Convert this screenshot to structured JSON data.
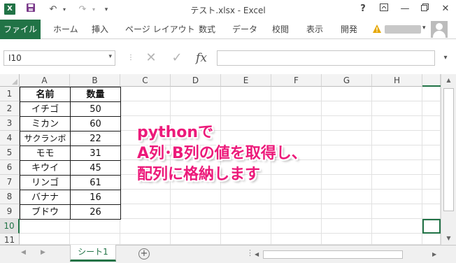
{
  "window": {
    "title": "テスト.xlsx - Excel",
    "help": "?",
    "app_icon": "X"
  },
  "quick_access": {
    "save_icon": "save-icon",
    "undo_icon": "undo-icon",
    "redo_icon": "redo-icon"
  },
  "ribbon": {
    "file_tab": "ファイル",
    "tabs": [
      "ホーム",
      "挿入",
      "ページ レイアウト",
      "数式",
      "データ",
      "校閲",
      "表示",
      "開発"
    ]
  },
  "formula_bar": {
    "name_box": "I10",
    "fx": "fx",
    "formula": ""
  },
  "columns": [
    "A",
    "B",
    "C",
    "D",
    "E",
    "F",
    "G",
    "H"
  ],
  "rows": [
    "1",
    "2",
    "3",
    "4",
    "5",
    "6",
    "7",
    "8",
    "9",
    "10",
    "11"
  ],
  "table": {
    "header": [
      "名前",
      "数量"
    ],
    "rows": [
      [
        "イチゴ",
        "50"
      ],
      [
        "ミカン",
        "60"
      ],
      [
        "サクランボ",
        "22"
      ],
      [
        "モモ",
        "31"
      ],
      [
        "キウイ",
        "45"
      ],
      [
        "リンゴ",
        "61"
      ],
      [
        "バナナ",
        "16"
      ],
      [
        "ブドウ",
        "26"
      ]
    ]
  },
  "annotation": {
    "line1": "pythonで",
    "line2": "A列･B列の値を取得し、",
    "line3": "配列に格納します",
    "color": "#ec1a7a"
  },
  "sheets": {
    "active": "シート1",
    "add_icon": "plus-circle-icon"
  },
  "colors": {
    "excel_green": "#217346"
  }
}
